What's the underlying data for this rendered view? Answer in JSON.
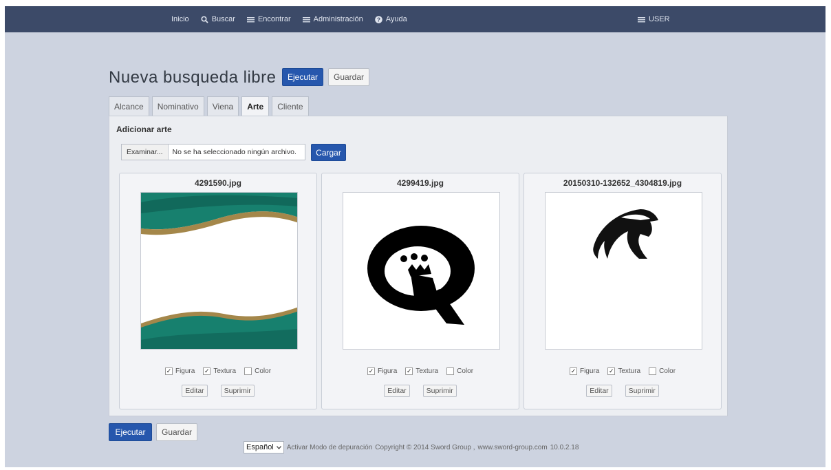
{
  "nav": {
    "items": [
      {
        "label": "Inicio",
        "icon": ""
      },
      {
        "label": "Buscar",
        "icon": "search-icon"
      },
      {
        "label": "Encontrar",
        "icon": "menu-icon"
      },
      {
        "label": "Administración",
        "icon": "menu-icon"
      },
      {
        "label": "Ayuda",
        "icon": "help-icon"
      }
    ],
    "user": "USER"
  },
  "page": {
    "title": "Nueva busqueda libre",
    "run_label": "Ejecutar",
    "save_label": "Guardar"
  },
  "tabs": [
    "Alcance",
    "Nominativo",
    "Viena",
    "Arte",
    "Cliente"
  ],
  "active_tab": "Arte",
  "art_section": {
    "title": "Adicionar arte",
    "browse_label": "Examinar...",
    "file_status": "No se ha seleccionado ningún archivo.",
    "upload_label": "Cargar"
  },
  "cards": [
    {
      "filename": "4291590.jpg",
      "image": "green-wave-banner",
      "options": {
        "figura": "Figura",
        "textura": "Textura",
        "color": "Color"
      },
      "checked": {
        "figura": true,
        "textura": true,
        "color": false
      },
      "edit_label": "Editar",
      "delete_label": "Suprimir"
    },
    {
      "filename": "4299419.jpg",
      "image": "q-crown-logo",
      "options": {
        "figura": "Figura",
        "textura": "Textura",
        "color": "Color"
      },
      "checked": {
        "figura": true,
        "textura": true,
        "color": false
      },
      "edit_label": "Editar",
      "delete_label": "Suprimir"
    },
    {
      "filename": "20150310-132652_4304819.jpg",
      "image": "eagle-head-logo",
      "options": {
        "figura": "Figura",
        "textura": "Textura",
        "color": "Color"
      },
      "checked": {
        "figura": true,
        "textura": true,
        "color": false
      },
      "edit_label": "Editar",
      "delete_label": "Suprimir"
    }
  ],
  "footer": {
    "language": "Español",
    "debug_link": "Activar Modo de depuración",
    "copyright": "Copyright © 2014 Sword Group ,",
    "site_link": "www.sword-group.com",
    "version": "10.0.2.18"
  },
  "colors": {
    "navbar": "#3c4a68",
    "page_background": "#cdd3e0",
    "primary_button": "#2657ad",
    "banner_green": "#17806e",
    "banner_gold": "#a4874a"
  }
}
